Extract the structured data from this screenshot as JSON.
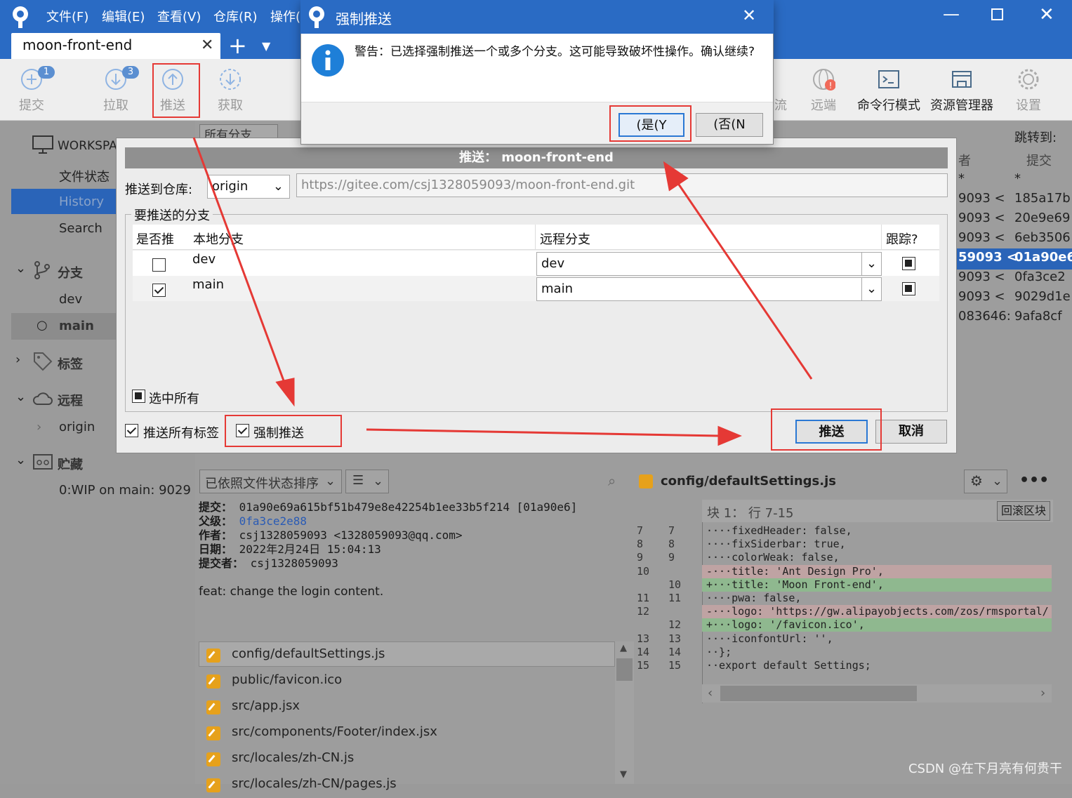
{
  "window": {
    "menus": [
      "文件(F)",
      "编辑(E)",
      "查看(V)",
      "仓库(R)",
      "操作("
    ],
    "tab_label": "moon-front-end"
  },
  "toolbar": {
    "commit": {
      "label": "提交",
      "badge": "1"
    },
    "pull": {
      "label": "拉取",
      "badge": "3"
    },
    "push": {
      "label": "推送"
    },
    "fetch": {
      "label": "获取"
    },
    "gitflow": {
      "label": "流"
    },
    "remote": {
      "label": "远端"
    },
    "terminal": {
      "label": "命令行模式"
    },
    "explorer": {
      "label": "资源管理器"
    },
    "settings": {
      "label": "设置"
    }
  },
  "sidebar": {
    "workspace": "WORKSPA",
    "file_status": "文件状态",
    "history": "History",
    "search": "Search",
    "branches_header": "分支",
    "branches": [
      "dev",
      "main"
    ],
    "tags_header": "标签",
    "remotes_header": "远程",
    "remotes": [
      "origin"
    ],
    "stash_header": "贮藏",
    "stashes": [
      "0:WIP on main: 9029"
    ]
  },
  "history": {
    "branch_filter": "所有分支",
    "jump_label": "跳转到:",
    "col_author_partial": "者",
    "col_commit": "提交",
    "rows": [
      {
        "author": "*",
        "hash": "*"
      },
      {
        "author": "9093 <",
        "hash": "185a17b"
      },
      {
        "author": "9093 <",
        "hash": "20e9e69"
      },
      {
        "author": "9093 <",
        "hash": "6eb3506"
      },
      {
        "author": "59093 <",
        "hash": "01a90e6"
      },
      {
        "author": "9093 <",
        "hash": "0fa3ce2"
      },
      {
        "author": "9093 <",
        "hash": "9029d1e"
      },
      {
        "author": "083646:",
        "hash": "9afa8cf"
      }
    ]
  },
  "push_dialog": {
    "title": "推送： moon-front-end",
    "repo_label": "推送到仓库:",
    "repo_value": "origin",
    "repo_url": "https://gitee.com/csj1328059093/moon-front-end.git",
    "branches_group": "要推送的分支",
    "col_push": "是否推",
    "col_local": "本地分支",
    "col_remote": "远程分支",
    "col_track": "跟踪?",
    "rows": [
      {
        "checked": false,
        "local": "dev",
        "remote": "dev"
      },
      {
        "checked": true,
        "local": "main",
        "remote": "main"
      }
    ],
    "select_all": "选中所有",
    "push_all_tags": "推送所有标签",
    "force_push": "强制推送",
    "push_button": "推送",
    "cancel_button": "取消"
  },
  "confirm_dialog": {
    "title": "强制推送",
    "message": "警告：已选择强制推送一个或多个分支。这可能导致破坏性操作。确认继续?",
    "yes_button": "(是(Y",
    "no_button": "(否(N"
  },
  "commit_details": {
    "sort_label": "已依照文件状态排序",
    "commit_label": "提交：",
    "commit_value": "01a90e69a615bf51b479e8e42254b1ee33b5f214 [01a90e6]",
    "parent_label": "父级：",
    "parent_value": "0fa3ce2e88",
    "author_label": "作者：",
    "author_value": "csj1328059093 <1328059093@qq.com>",
    "date_label": "日期：",
    "date_value": "2022年2月24日 15:04:13",
    "committer_label": "提交者：",
    "committer_value": "csj1328059093",
    "message": "feat: change the login content.",
    "files": [
      "config/defaultSettings.js",
      "public/favicon.ico",
      "src/app.jsx",
      "src/components/Footer/index.jsx",
      "src/locales/zh-CN.js",
      "src/locales/zh-CN/pages.js"
    ]
  },
  "diff": {
    "file": "config/defaultSettings.js",
    "hunk_label": "块 1： 行 7-15",
    "revert_button": "回滚区块",
    "lines": [
      {
        "old": "7",
        "new": "7",
        "type": "ctx",
        "text": "····fixedHeader: false,"
      },
      {
        "old": "8",
        "new": "8",
        "type": "ctx",
        "text": "····fixSiderbar: true,"
      },
      {
        "old": "9",
        "new": "9",
        "type": "ctx",
        "text": "····colorWeak: false,"
      },
      {
        "old": "10",
        "new": "",
        "type": "del",
        "text": "-···title: 'Ant Design Pro',"
      },
      {
        "old": "",
        "new": "10",
        "type": "add",
        "text": "+···title: 'Moon Front-end',"
      },
      {
        "old": "11",
        "new": "11",
        "type": "ctx",
        "text": "····pwa: false,"
      },
      {
        "old": "12",
        "new": "",
        "type": "del",
        "text": "-···logo: 'https://gw.alipayobjects.com/zos/rmsportal/"
      },
      {
        "old": "",
        "new": "12",
        "type": "add",
        "text": "+···logo: '/favicon.ico',"
      },
      {
        "old": "13",
        "new": "13",
        "type": "ctx",
        "text": "····iconfontUrl: '',"
      },
      {
        "old": "14",
        "new": "14",
        "type": "ctx",
        "text": "··};"
      },
      {
        "old": "15",
        "new": "15",
        "type": "ctx",
        "text": "··export default Settings;"
      }
    ]
  },
  "watermark": "CSDN @在下月亮有何贵干",
  "colors": {
    "accent": "#2a6bc4",
    "highlight_box": "#e53935",
    "diff_add": "#c8f0c8",
    "diff_del": "#f6cfcf"
  }
}
